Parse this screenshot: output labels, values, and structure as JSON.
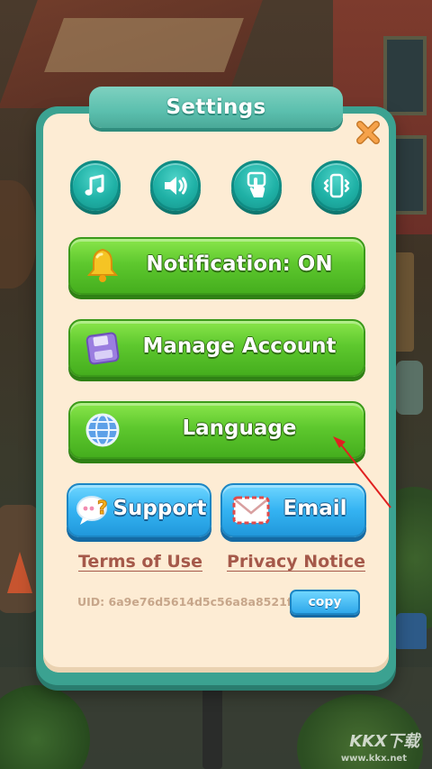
{
  "title": "Settings",
  "icons": [
    {
      "name": "music-note-icon"
    },
    {
      "name": "speaker-icon"
    },
    {
      "name": "tap-hand-icon"
    },
    {
      "name": "vibration-phone-icon"
    }
  ],
  "buttons": {
    "notification": "Notification: ON",
    "manage_account": "Manage Account",
    "language": "Language",
    "support": "Support",
    "email": "Email"
  },
  "links": {
    "terms": "Terms of Use",
    "privacy": "Privacy Notice"
  },
  "uid": "UID: 6a9e76d5614d5c56a8a8521f",
  "copy_label": "copy",
  "watermark": {
    "brand": "KKX下载",
    "url": "www.kkx.net"
  },
  "colors": {
    "panel_border": "#3ba291",
    "panel_fill": "#fdecd4",
    "green_button": "#5ec82e",
    "blue_button": "#34b3f2",
    "link_text": "#a5594a"
  }
}
